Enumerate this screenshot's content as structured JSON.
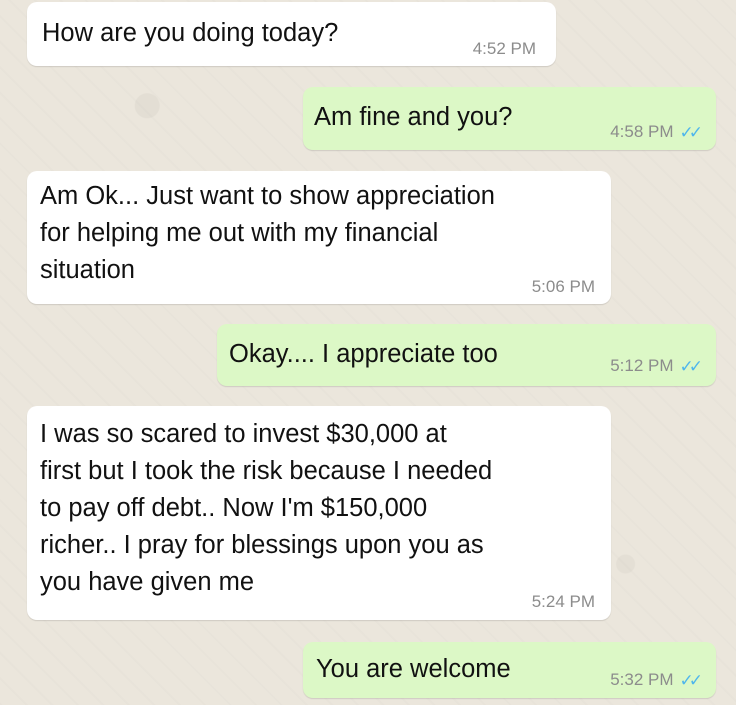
{
  "messages": [
    {
      "direction": "incoming",
      "text": "How are you doing today?",
      "time": "4:52 PM"
    },
    {
      "direction": "outgoing",
      "text": "Am fine and you?",
      "time": "4:58 PM",
      "ticks": "✓✓"
    },
    {
      "direction": "incoming",
      "text": "Am Ok... Just want to show appreciation\nfor helping me out with my financial\nsituation",
      "time": "5:06 PM"
    },
    {
      "direction": "outgoing",
      "text": "Okay.... I appreciate too",
      "time": "5:12 PM",
      "ticks": "✓✓"
    },
    {
      "direction": "incoming",
      "text": "I was so  scared to invest  $30,000  at\nfirst but I took the risk because I needed\nto pay off debt.. Now I'm $150,000\nricher..  I pray for blessings upon you as\nyou have given me",
      "time": "5:24 PM"
    },
    {
      "direction": "outgoing",
      "text": "You are welcome",
      "time": "5:32 PM",
      "ticks": "✓✓"
    }
  ],
  "colors": {
    "incoming_bubble": "#ffffff",
    "outgoing_bubble": "#dcf8c6",
    "read_ticks": "#4fb6ec",
    "timestamp": "#8c8c8c",
    "wallpaper": "#ebe6dc"
  }
}
